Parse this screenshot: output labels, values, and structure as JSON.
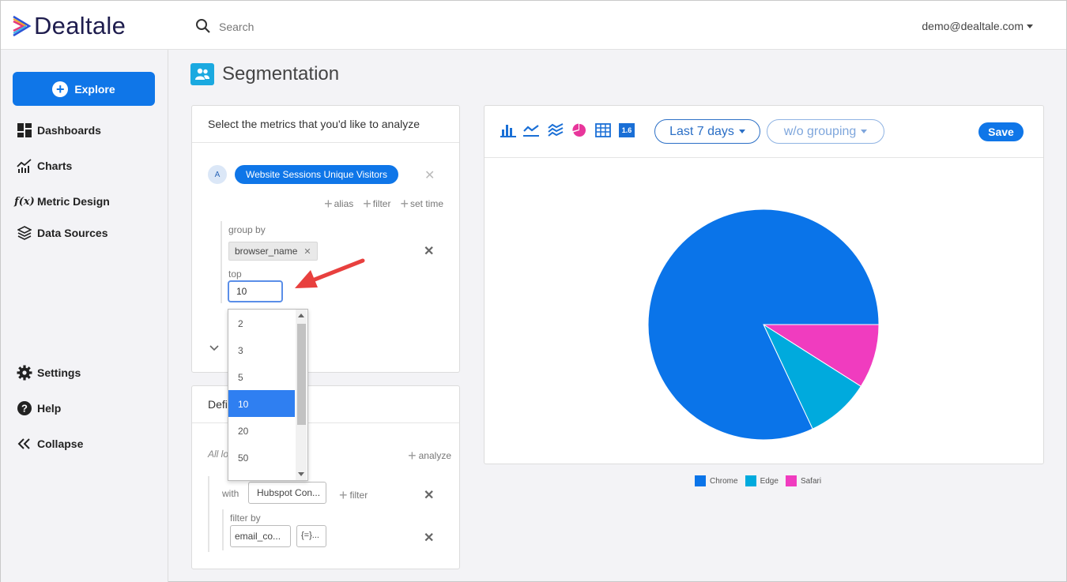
{
  "app": {
    "brand": "Dealtale",
    "user_email": "demo@dealtale.com"
  },
  "search": {
    "placeholder": "Search"
  },
  "sidebar": {
    "explore_label": "Explore",
    "items": [
      {
        "label": "Dashboards",
        "icon": "dashboard-icon"
      },
      {
        "label": "Charts",
        "icon": "chart-icon"
      },
      {
        "label": "Metric Design",
        "icon": "function-icon"
      },
      {
        "label": "Data Sources",
        "icon": "layers-icon"
      },
      {
        "label": "Settings",
        "icon": "gear-icon"
      },
      {
        "label": "Help",
        "icon": "help-icon"
      },
      {
        "label": "Collapse",
        "icon": "double-chevron-left-icon"
      }
    ]
  },
  "page": {
    "title": "Segmentation"
  },
  "metrics_panel": {
    "header": "Select the metrics that you'd like to analyze",
    "metric_letter": "A",
    "metric_name": "Website Sessions Unique Visitors",
    "links": [
      "alias",
      "filter",
      "set time"
    ],
    "group_by_label": "group by",
    "group_by_tag": "browser_name",
    "top_label": "top",
    "top_value": "10",
    "top_options": [
      "2",
      "3",
      "5",
      "10",
      "20",
      "50"
    ],
    "top_selected": "10"
  },
  "define_panel": {
    "header_visible": "Defi",
    "italic_visible": "All lo",
    "analyze_label": "analyze",
    "with_label": "with",
    "with_value": "Hubspot Con...",
    "filter_label": "filter",
    "filter_by_label": "filter by",
    "filter_field": "email_co...",
    "filter_op": "{=}..."
  },
  "chart_toolbar": {
    "icons": [
      "bar-chart-icon",
      "line-chart-icon",
      "area-chart-icon",
      "pie-chart-icon",
      "table-icon",
      "number-icon"
    ],
    "number_icon_text": "1.6",
    "date_range": "Last 7 days",
    "grouping": "w/o grouping",
    "save_label": "Save"
  },
  "colors": {
    "accent": "#0f76e8",
    "chrome": "#0a74e9",
    "edge": "#00aadd",
    "safari": "#f03cbf"
  },
  "chart_data": {
    "type": "pie",
    "title": "",
    "categories": [
      "Chrome",
      "Edge",
      "Safari"
    ],
    "values": [
      82,
      9,
      9
    ],
    "colors": [
      "#0a74e9",
      "#00aadd",
      "#f03cbf"
    ],
    "legend_position": "bottom"
  }
}
